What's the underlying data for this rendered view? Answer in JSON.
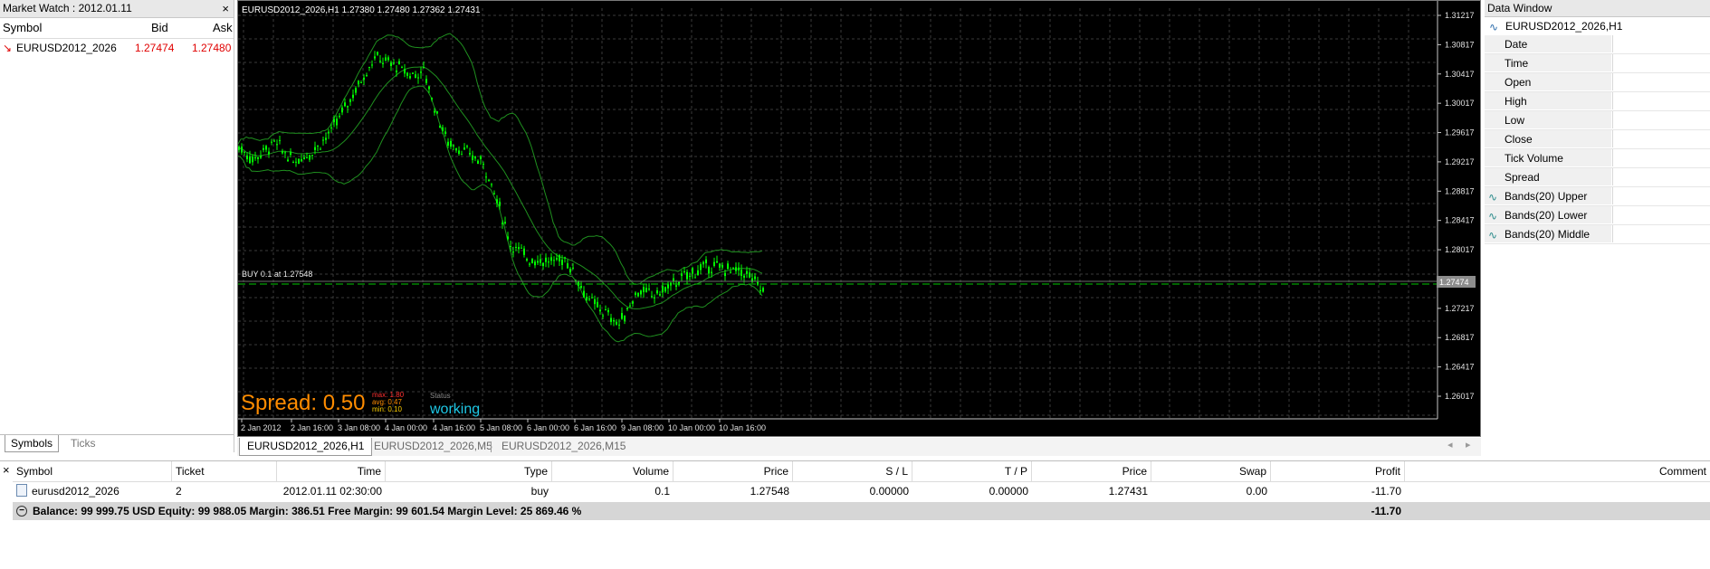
{
  "market_watch": {
    "title": "Market Watch : 2012.01.11",
    "close_glyph": "×",
    "columns": {
      "symbol": "Symbol",
      "bid": "Bid",
      "ask": "Ask"
    },
    "rows": [
      {
        "arrow": "↘",
        "symbol": "EURUSD2012_2026",
        "bid": "1.27474",
        "ask": "1.27480"
      }
    ],
    "tabs": [
      {
        "label": "Symbols"
      },
      {
        "label": "Ticks"
      }
    ]
  },
  "chart": {
    "header": "EURUSD2012_2026,H1  1.27380 1.27480 1.27362 1.27431",
    "order_label": "BUY 0.1 at 1.27548",
    "price_labels": [
      "1.31217",
      "1.30817",
      "1.30417",
      "1.30017",
      "1.29617",
      "1.29217",
      "1.28817",
      "1.28417",
      "1.28017",
      "1.27617",
      "1.27217",
      "1.26817",
      "1.26417",
      "1.26017"
    ],
    "current_price": "1.27474",
    "time_labels": [
      "2 Jan 2012",
      "2 Jan 16:00",
      "3 Jan 08:00",
      "4 Jan 00:00",
      "4 Jan 16:00",
      "5 Jan 08:00",
      "6 Jan 00:00",
      "6 Jan 16:00",
      "9 Jan 08:00",
      "10 Jan 00:00",
      "10 Jan 16:00"
    ],
    "spread": {
      "label": "Spread: 0.50",
      "max": "max: 1.80",
      "avg": "avg: 0.47",
      "min": "min: 0.10"
    },
    "status": {
      "label": "Status",
      "value": "working"
    },
    "colors": {
      "candles": "#00ff00",
      "bands": "#1f8f1f",
      "grid": "#3a3a3a",
      "spread": "#ff8c00",
      "status": "#1ec8e6"
    },
    "ohlc_estimate": {
      "y_top_price": 1.31217,
      "y_bottom_price": 1.26017
    }
  },
  "chart_tabs": [
    {
      "label": "EURUSD2012_2026,H1",
      "active": true
    },
    {
      "label": "EURUSD2012_2026,M5",
      "active": false
    },
    {
      "label": "EURUSD2012_2026,M15",
      "active": false
    }
  ],
  "chart_tab_arrows": {
    "left": "◂",
    "right": "▸"
  },
  "data_window": {
    "title": "Data Window",
    "symbol": "EURUSD2012_2026,H1",
    "rows": [
      "Date",
      "Time",
      "Open",
      "High",
      "Low",
      "Close",
      "Tick Volume",
      "Spread"
    ],
    "indicators": [
      "Bands(20) Upper",
      "Bands(20) Lower",
      "Bands(20) Middle"
    ]
  },
  "terminal": {
    "close_glyph": "×",
    "columns": [
      "Symbol",
      "Ticket",
      "Time",
      "Type",
      "Volume",
      "Price",
      "S / L",
      "T / P",
      "Price",
      "Swap",
      "Profit",
      "Comment"
    ],
    "trade": {
      "symbol": "eurusd2012_2026",
      "ticket": "2",
      "time": "2012.01.11 02:30:00",
      "type": "buy",
      "volume": "0.1",
      "price": "1.27548",
      "sl": "0.00000",
      "tp": "0.00000",
      "cur_price": "1.27431",
      "swap": "0.00",
      "profit": "-11.70"
    },
    "balance": "Balance: 99 999.75 USD  Equity: 99 988.05  Margin: 386.51  Free Margin: 99 601.54  Margin Level: 25 869.46 %",
    "total_profit": "-11.70"
  }
}
